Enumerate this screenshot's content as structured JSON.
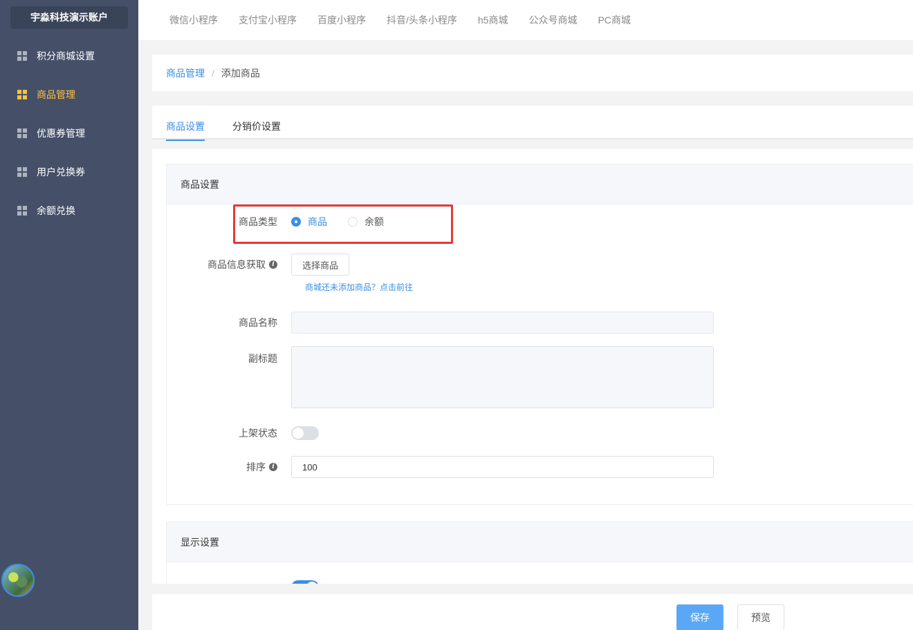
{
  "sidebar": {
    "account_name": "宇淼科技演示账户",
    "items": [
      {
        "label": "积分商城设置",
        "icon": "grid-icon",
        "active": false
      },
      {
        "label": "商品管理",
        "icon": "grid-icon",
        "active": true
      },
      {
        "label": "优惠券管理",
        "icon": "grid-icon",
        "active": false
      },
      {
        "label": "用户兑换券",
        "icon": "grid-icon",
        "active": false
      },
      {
        "label": "余额兑换",
        "icon": "grid-icon",
        "active": false
      }
    ]
  },
  "top_tabs": [
    "微信小程序",
    "支付宝小程序",
    "百度小程序",
    "抖音/头条小程序",
    "h5商城",
    "公众号商城",
    "PC商城"
  ],
  "breadcrumb": {
    "parent": "商品管理",
    "separator": "/",
    "current": "添加商品"
  },
  "tabs": [
    {
      "label": "商品设置",
      "active": true
    },
    {
      "label": "分销价设置",
      "active": false
    }
  ],
  "section_product": {
    "title": "商品设置",
    "type_label": "商品类型",
    "type_options": [
      {
        "label": "商品",
        "checked": true
      },
      {
        "label": "余额",
        "checked": false
      }
    ],
    "fetch_label": "商品信息获取",
    "fetch_button": "选择商品",
    "fetch_hint": "商城还未添加商品？点击前往",
    "name_label": "商品名称",
    "name_value": "",
    "subtitle_label": "副标题",
    "subtitle_value": "",
    "status_label": "上架状态",
    "status_on": false,
    "sort_label": "排序",
    "sort_value": "100"
  },
  "section_display": {
    "title": "显示设置",
    "toggle_on": true
  },
  "footer": {
    "save": "保存",
    "preview": "预览"
  },
  "colors": {
    "sidebar": "#455068",
    "accent": "#3a8ee6",
    "active_nav": "#ffc13b",
    "highlight": "#e53935"
  }
}
